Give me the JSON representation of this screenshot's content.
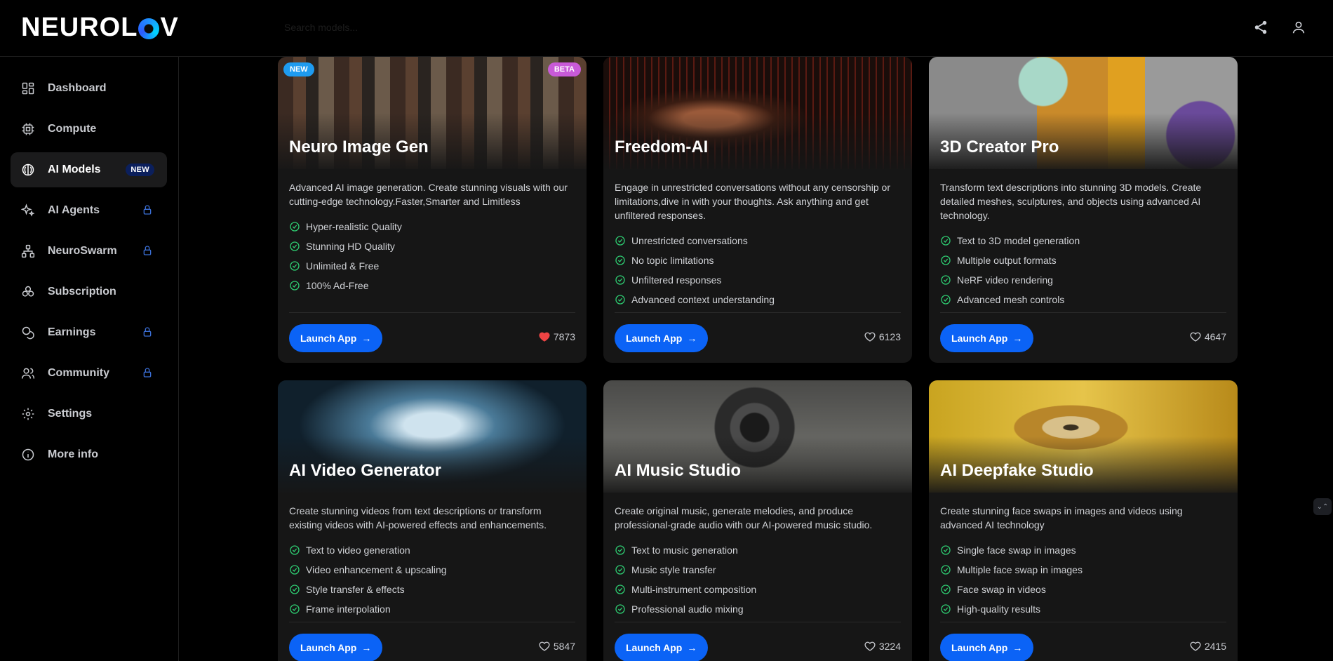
{
  "app": {
    "logo_text_left": "NEURO",
    "logo_text_l": "L",
    "logo_text_right": "V",
    "logo_brand": "NEUROLOV",
    "search_placeholder": "Search models..."
  },
  "header": {
    "share_icon": "share-icon",
    "user_icon": "user-icon"
  },
  "sidebar": {
    "items": [
      {
        "label": "Dashboard",
        "icon": "dashboard-icon"
      },
      {
        "label": "Compute",
        "icon": "chip-icon"
      },
      {
        "label": "AI Models",
        "icon": "brain-icon",
        "badge": "NEW",
        "active": true
      },
      {
        "label": "AI Agents",
        "icon": "sparkles-icon",
        "locked": true
      },
      {
        "label": "NeuroSwarm",
        "icon": "network-icon",
        "locked": true
      },
      {
        "label": "Subscription",
        "icon": "subscription-icon"
      },
      {
        "label": "Earnings",
        "icon": "coins-icon",
        "locked": true
      },
      {
        "label": "Community",
        "icon": "users-icon",
        "locked": true
      },
      {
        "label": "Settings",
        "icon": "gear-icon"
      },
      {
        "label": "More info",
        "icon": "info-icon"
      }
    ]
  },
  "cards": [
    {
      "title": "Neuro Image Gen",
      "tag_left": "NEW",
      "tag_right": "BETA",
      "description": "Advanced AI image generation. Create stunning visuals with our cutting-edge technology.Faster,Smarter and Limitless",
      "features": [
        "Hyper-realistic Quality",
        "Stunning HD Quality",
        "Unlimited & Free",
        "100% Ad-Free"
      ],
      "launch_label": "Launch App",
      "likes": "7873",
      "liked": true
    },
    {
      "title": "Freedom-AI",
      "description": "Engage in unrestricted conversations without any censorship or limitations,dive in with your thoughts. Ask anything and get unfiltered responses.",
      "features": [
        "Unrestricted conversations",
        "No topic limitations",
        "Unfiltered responses",
        "Advanced context understanding"
      ],
      "launch_label": "Launch App",
      "likes": "6123",
      "liked": false
    },
    {
      "title": "3D Creator Pro",
      "description": "Transform text descriptions into stunning 3D models. Create detailed meshes, sculptures, and objects using advanced AI technology.",
      "features": [
        "Text to 3D model generation",
        "Multiple output formats",
        "NeRF video rendering",
        "Advanced mesh controls"
      ],
      "launch_label": "Launch App",
      "likes": "4647",
      "liked": false
    },
    {
      "title": "AI Video Generator",
      "description": "Create stunning videos from text descriptions or transform existing videos with AI-powered effects and enhancements.",
      "features": [
        "Text to video generation",
        "Video enhancement & upscaling",
        "Style transfer & effects",
        "Frame interpolation"
      ],
      "launch_label": "Launch App",
      "likes": "5847",
      "liked": false
    },
    {
      "title": "AI Music Studio",
      "description": "Create original music, generate melodies, and produce professional-grade audio with our AI-powered music studio.",
      "features": [
        "Text to music generation",
        "Music style transfer",
        "Multi-instrument composition",
        "Professional audio mixing"
      ],
      "launch_label": "Launch App",
      "likes": "3224",
      "liked": false
    },
    {
      "title": "AI Deepfake Studio",
      "description": "Create stunning face swaps in images and videos using advanced AI technology",
      "features": [
        "Single face swap in images",
        "Multiple face swap in images",
        "Face swap in videos",
        "High-quality results"
      ],
      "launch_label": "Launch App",
      "likes": "2415",
      "liked": false
    }
  ],
  "colors": {
    "accent": "#0b63f6",
    "check": "#2ecc71",
    "heart_liked": "#ef4444",
    "badge_new": "#1e9bf0",
    "badge_beta": "#c85ad8"
  }
}
